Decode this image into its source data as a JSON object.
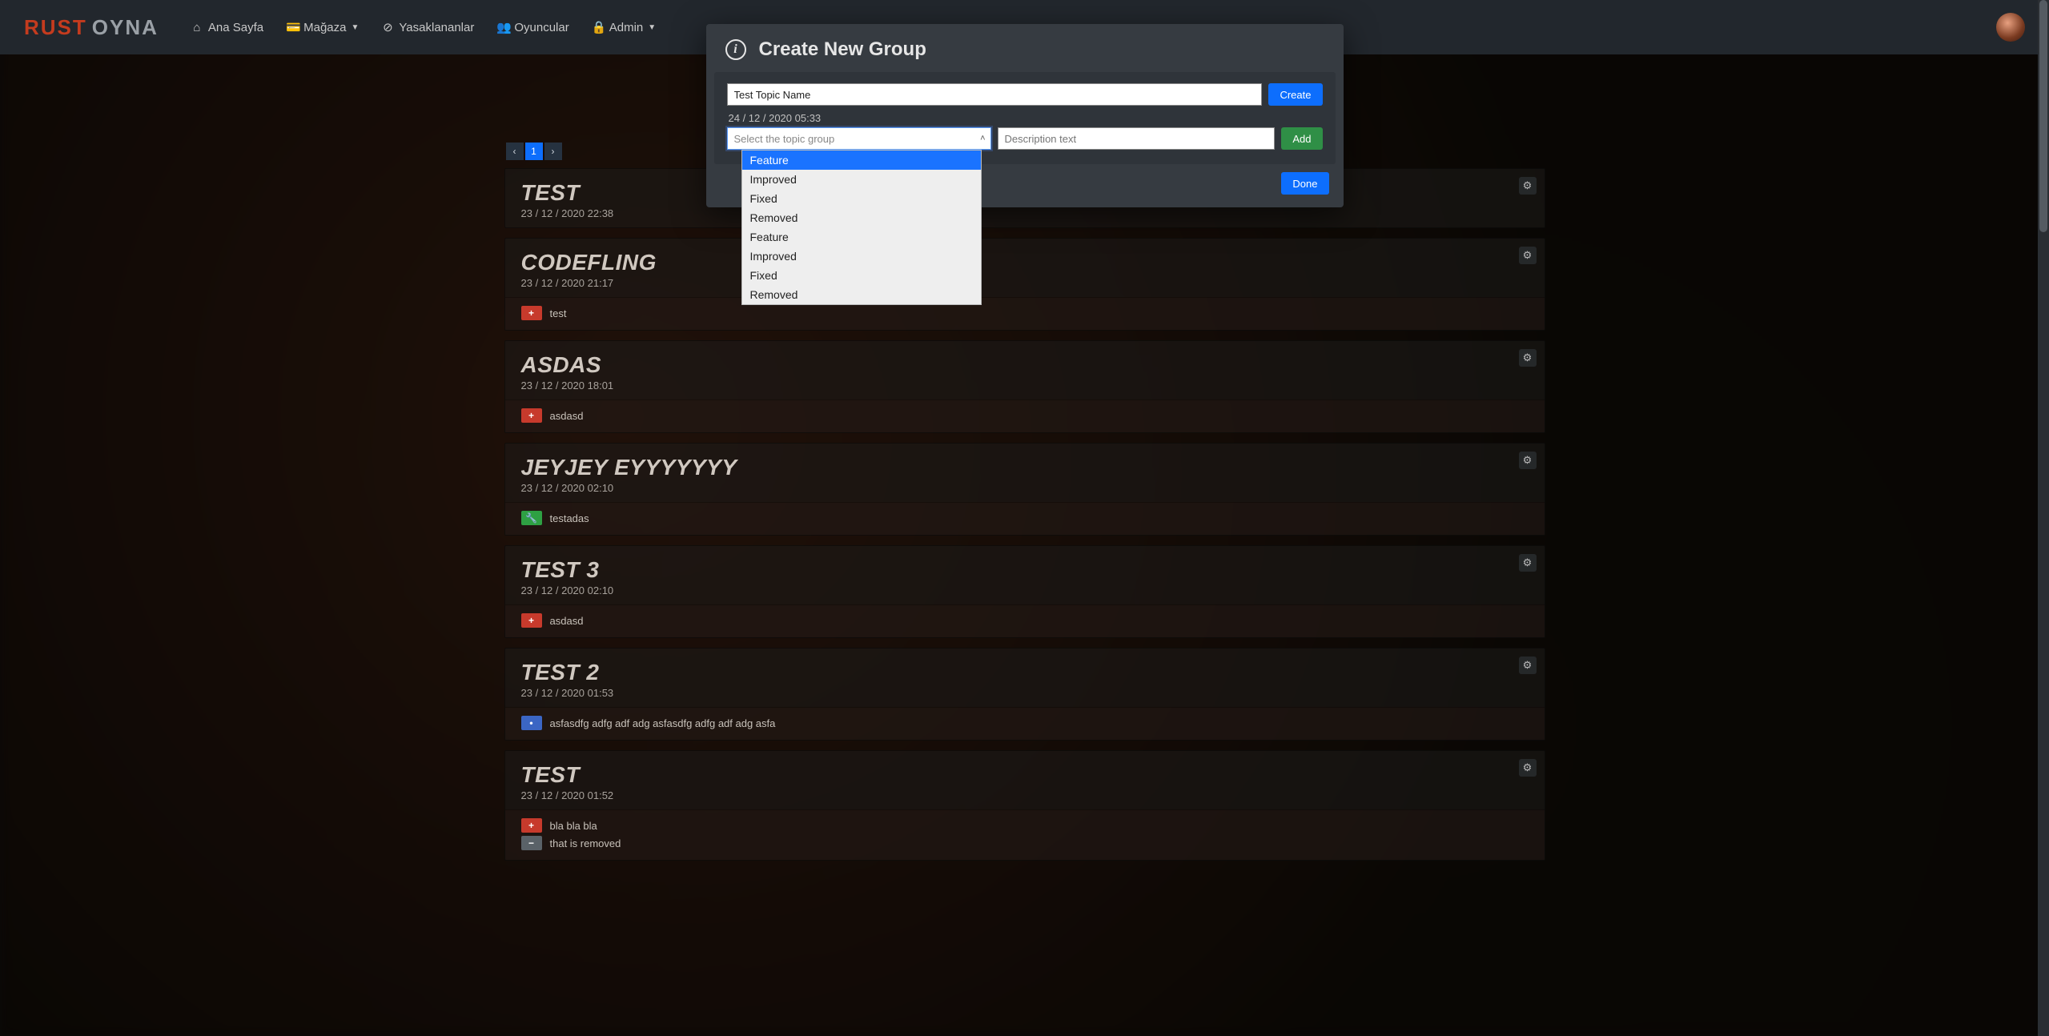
{
  "logo": {
    "part1": "RUST",
    "part2": "OYNA"
  },
  "nav": {
    "home": "Ana Sayfa",
    "store": "Mağaza",
    "banned": "Yasaklananlar",
    "players": "Oyuncular",
    "admin": "Admin"
  },
  "pagination": {
    "prev": "‹",
    "page1": "1",
    "next": "›"
  },
  "modal": {
    "title": "Create New Group",
    "topic_value": "Test Topic Name",
    "create": "Create",
    "timestamp": "24 / 12 / 2020 05:33",
    "combo_placeholder": "Select the topic group",
    "desc_placeholder": "Description text",
    "add": "Add",
    "done": "Done",
    "options": [
      "Feature",
      "Improved",
      "Fixed",
      "Removed",
      "Feature",
      "Improved",
      "Fixed",
      "Removed"
    ]
  },
  "topics": [
    {
      "title": "TEST",
      "date": "23 / 12 / 2020 22:38",
      "items": []
    },
    {
      "title": "CODEFLING",
      "date": "23 / 12 / 2020 21:17",
      "items": [
        {
          "kind": "plus",
          "text": "test"
        }
      ]
    },
    {
      "title": "ASDAS",
      "date": "23 / 12 / 2020 18:01",
      "items": [
        {
          "kind": "plus",
          "text": "asdasd"
        }
      ]
    },
    {
      "title": "JEYJEY EYYYYYYY",
      "date": "23 / 12 / 2020 02:10",
      "items": [
        {
          "kind": "wrench",
          "text": "testadas"
        }
      ]
    },
    {
      "title": "TEST 3",
      "date": "23 / 12 / 2020 02:10",
      "items": [
        {
          "kind": "plus",
          "text": "asdasd"
        }
      ]
    },
    {
      "title": "TEST 2",
      "date": "23 / 12 / 2020 01:53",
      "items": [
        {
          "kind": "dot",
          "text": "asfasdfg adfg adf adg asfasdfg adfg adf adg asfa"
        }
      ]
    },
    {
      "title": "TEST",
      "date": "23 / 12 / 2020 01:52",
      "items": [
        {
          "kind": "plus",
          "text": "bla bla bla"
        },
        {
          "kind": "minus",
          "text": "that is removed"
        }
      ]
    }
  ],
  "icons": {
    "plus": "+",
    "minus": "−",
    "dot": "•",
    "wrench": "🔧",
    "gear": "⚙"
  }
}
